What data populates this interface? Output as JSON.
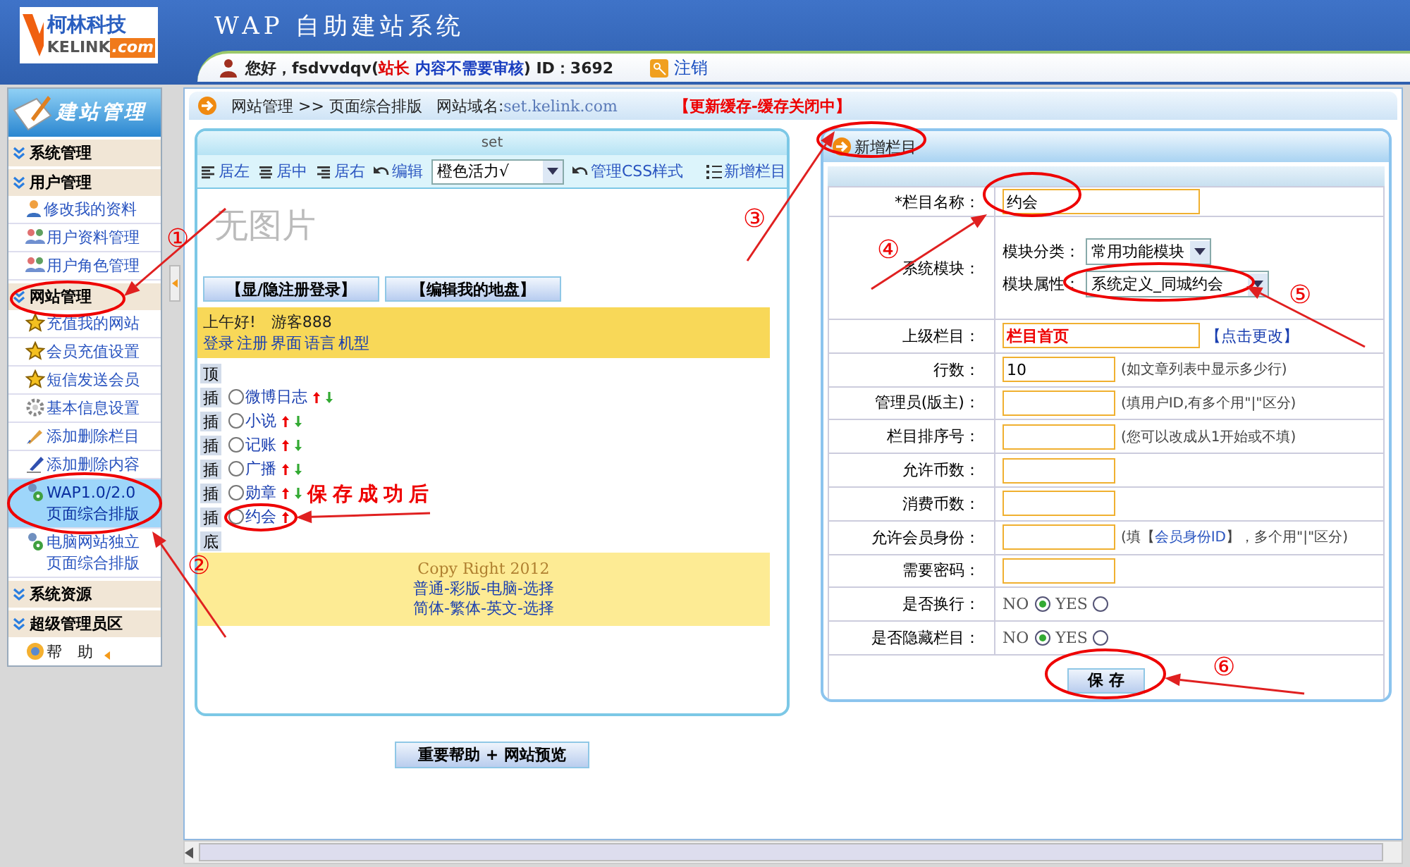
{
  "header": {
    "brand": "柯林科技",
    "brand_en": "KELINK",
    "brand_domain": ".com",
    "title": "WAP 自助建站系统",
    "user_greeting": "您好，fsdvvdqv(",
    "user_role": "站长",
    "user_audit": " 内容不需要审核",
    "user_id": ") ID：3692",
    "logout": "注销"
  },
  "sidebar": {
    "title": "建站管理",
    "items": [
      {
        "kind": "section",
        "label": "系统管理",
        "selected": false
      },
      {
        "kind": "section",
        "label": "用户管理",
        "selected": false
      },
      {
        "kind": "link",
        "label": "修改我的资料",
        "selected": false
      },
      {
        "kind": "link",
        "label": "用户资料管理",
        "selected": false
      },
      {
        "kind": "link",
        "label": "用户角色管理",
        "selected": false
      },
      {
        "kind": "section",
        "label": "网站管理",
        "selected": false
      },
      {
        "kind": "link",
        "label": "充值我的网站",
        "selected": false
      },
      {
        "kind": "link",
        "label": "会员充值设置",
        "selected": false
      },
      {
        "kind": "link",
        "label": "短信发送会员",
        "selected": false
      },
      {
        "kind": "link",
        "label": "基本信息设置",
        "selected": false
      },
      {
        "kind": "link",
        "label": "添加删除栏目",
        "selected": false
      },
      {
        "kind": "link",
        "label": "添加删除内容",
        "selected": false
      },
      {
        "kind": "link",
        "label": "WAP1.0/2.0",
        "label2": "页面综合排版",
        "selected": true
      },
      {
        "kind": "link",
        "label": "电脑网站独立",
        "label2": "页面综合排版",
        "selected": false
      },
      {
        "kind": "section",
        "label": "系统资源",
        "selected": false
      },
      {
        "kind": "section",
        "label": "超级管理员区",
        "selected": false
      },
      {
        "kind": "help",
        "label": "帮　助",
        "selected": false
      }
    ]
  },
  "breadcrumb": {
    "path": "网站管理 >> 页面综合排版",
    "domain_label": "网站域名:",
    "domain": "set.kelink.com",
    "cache_status": "【更新缓存-缓存关闭中】"
  },
  "layout_panel": {
    "title": "set",
    "toolbar": [
      {
        "kind": "align-left",
        "label": "居左"
      },
      {
        "kind": "align-center",
        "label": "居中"
      },
      {
        "kind": "align-right",
        "label": "居右"
      },
      {
        "kind": "undo",
        "label": "编辑"
      },
      {
        "kind": "select",
        "label": "橙色活力√"
      },
      {
        "kind": "undo",
        "label": "管理CSS样式"
      },
      {
        "kind": "list",
        "label": "新增栏目"
      }
    ],
    "image_placeholder": "无图片",
    "buttons": [
      "【显/隐注册登录】",
      "【编辑我的地盘】"
    ],
    "greeting": "上午好!",
    "guest": "游客888",
    "links": [
      "登录",
      "注册",
      "界面",
      "语言",
      "机型"
    ],
    "top_button": "顶",
    "rows": [
      {
        "insert": "插",
        "label": "微博日志",
        "selected": false,
        "move_down": true
      },
      {
        "insert": "插",
        "label": "小说",
        "selected": false,
        "move_down": true
      },
      {
        "insert": "插",
        "label": "记账",
        "selected": false,
        "move_down": true
      },
      {
        "insert": "插",
        "label": "广播",
        "selected": false,
        "move_down": true
      },
      {
        "insert": "插",
        "label": "勋章",
        "selected": false,
        "move_down": true
      },
      {
        "insert": "插",
        "label": "约会",
        "selected": false,
        "move_down": false
      }
    ],
    "bottom_button": "底",
    "footer": {
      "copyright": "Copy Right 2012",
      "lines": [
        "普通-彩版-电脑-选择",
        "简体-繁体-英文-选择"
      ]
    }
  },
  "preview_button": "重要帮助 + 网站预览",
  "form": {
    "title": "新增栏目",
    "fields": [
      {
        "kind": "name",
        "label": "*栏目名称：",
        "value": "约会"
      },
      {
        "kind": "module",
        "label": "系统模块：",
        "category_label": "模块分类：",
        "category": "常用功能模块",
        "attribute_label": "模块属性：",
        "attribute": "系统定义_同城约会"
      },
      {
        "kind": "parent",
        "label": "上级栏目：",
        "value": "栏目首页",
        "link": "【点击更改】"
      },
      {
        "kind": "text",
        "label": "行数：",
        "value": "10",
        "hint": "(如文章列表中显示多少行)"
      },
      {
        "kind": "text",
        "label": "管理员(版主)：",
        "hint": "(填用户ID,有多个用\"|\"区分)"
      },
      {
        "kind": "text",
        "label": "栏目排序号：",
        "hint": "(您可以改成从1开始或不填)"
      },
      {
        "kind": "text",
        "label": "允许币数："
      },
      {
        "kind": "text",
        "label": "消费币数："
      },
      {
        "kind": "text",
        "label": "允许会员身份：",
        "hint": "(填【",
        "hint_link": "会员身份ID",
        "hint_end": "】，多个用\"|\"区分)"
      },
      {
        "kind": "text",
        "label": "需要密码："
      },
      {
        "kind": "radio",
        "label": "是否换行：",
        "options": [
          {
            "label": "NO",
            "selected": true
          },
          {
            "label": "YES",
            "selected": false
          }
        ]
      },
      {
        "kind": "radio",
        "label": "是否隐藏栏目：",
        "options": [
          {
            "label": "NO",
            "selected": true
          },
          {
            "label": "YES",
            "selected": false
          }
        ]
      }
    ],
    "save": "保 存"
  },
  "annotations": [
    {
      "label": "①"
    },
    {
      "label": "②"
    },
    {
      "label": "③"
    },
    {
      "label": "④"
    },
    {
      "label": "⑤"
    },
    {
      "label": "⑥"
    }
  ],
  "caption": "保存成功后"
}
